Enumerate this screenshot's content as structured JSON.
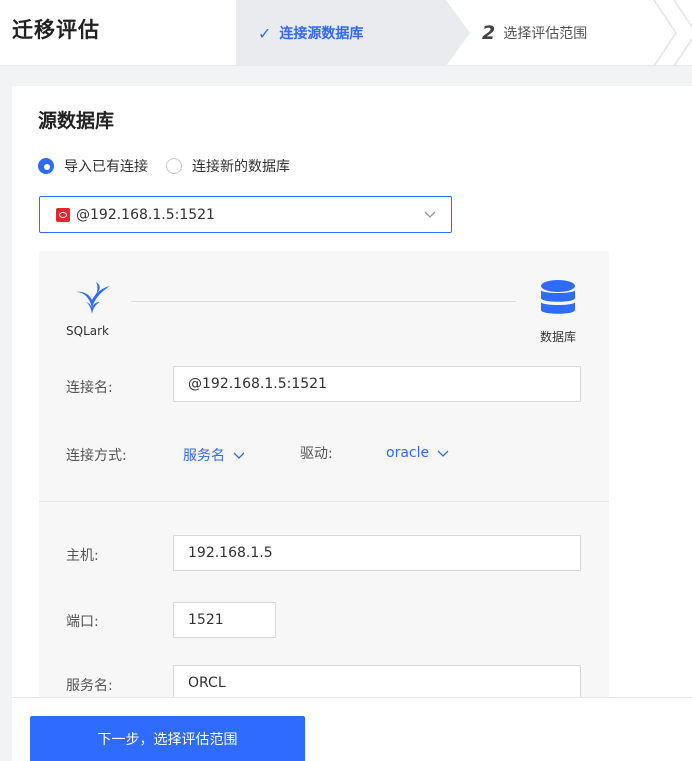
{
  "header": {
    "title": "迁移评估",
    "steps": [
      {
        "label": "连接源数据库",
        "state": "done"
      },
      {
        "number": "2",
        "label": "选择评估范围",
        "state": "pending"
      }
    ]
  },
  "source": {
    "section_title": "源数据库",
    "radio_options": [
      {
        "label": "导入已有连接",
        "checked": true
      },
      {
        "label": "连接新的数据库",
        "checked": false
      }
    ],
    "selected_connection": "@192.168.1.5:1521",
    "selected_connection_icon": "oracle-icon"
  },
  "panel": {
    "left_logo_caption": "SQLark",
    "right_logo_caption": "数据库",
    "connection_name_label": "连接名:",
    "connection_name_value": "@192.168.1.5:1521",
    "connect_method_label": "连接方式:",
    "connect_method_value": "服务名",
    "driver_label": "驱动:",
    "driver_value": "oracle",
    "host_label": "主机:",
    "host_value": "192.168.1.5",
    "port_label": "端口:",
    "port_value": "1521",
    "service_label": "服务名:",
    "service_value": "ORCL"
  },
  "footer": {
    "next_button": "下一步，选择评估范围"
  },
  "colors": {
    "accent": "#2f6bff",
    "oracle_red": "#e5262a"
  }
}
